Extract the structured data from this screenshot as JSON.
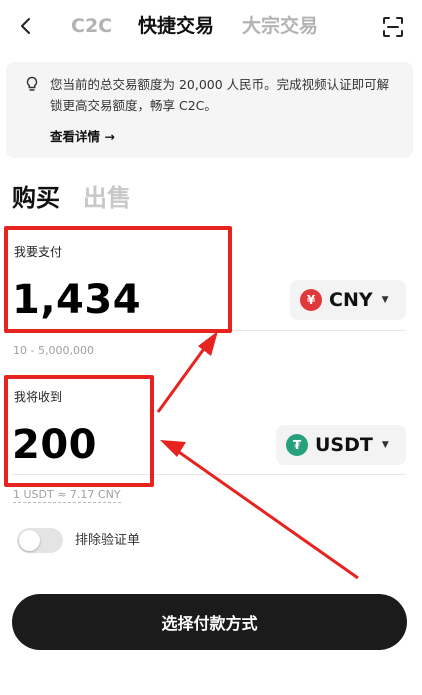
{
  "nav": {
    "back_icon": "chevron-left-icon",
    "tabs": [
      {
        "label": "C2C"
      },
      {
        "label": "快捷交易"
      },
      {
        "label": "大宗交易"
      }
    ],
    "scan_icon": "scan-icon"
  },
  "notice": {
    "icon": "lightbulb-icon",
    "text": "您当前的总交易额度为 20,000 人民币。完成视频认证即可解锁更高交易额度，畅享 C2C。",
    "link": "查看详情 →"
  },
  "side_tabs": {
    "buy": "购买",
    "sell": "出售"
  },
  "pay": {
    "label": "我要支付",
    "amount": "1,434",
    "currency": "CNY",
    "currency_symbol": "¥",
    "currency_color": "#e0393a",
    "range_hint": "10 - 5,000,000"
  },
  "receive": {
    "label": "我将收到",
    "amount": "200",
    "currency": "USDT",
    "currency_symbol": "₮",
    "currency_color": "#26a17b",
    "rate_hint": "1 USDT ≈ 7.17 CNY"
  },
  "exclude_verified": {
    "label": "排除验证单",
    "enabled": false
  },
  "cta": {
    "label": "选择付款方式"
  },
  "annotation": {
    "color": "#e6231f"
  }
}
